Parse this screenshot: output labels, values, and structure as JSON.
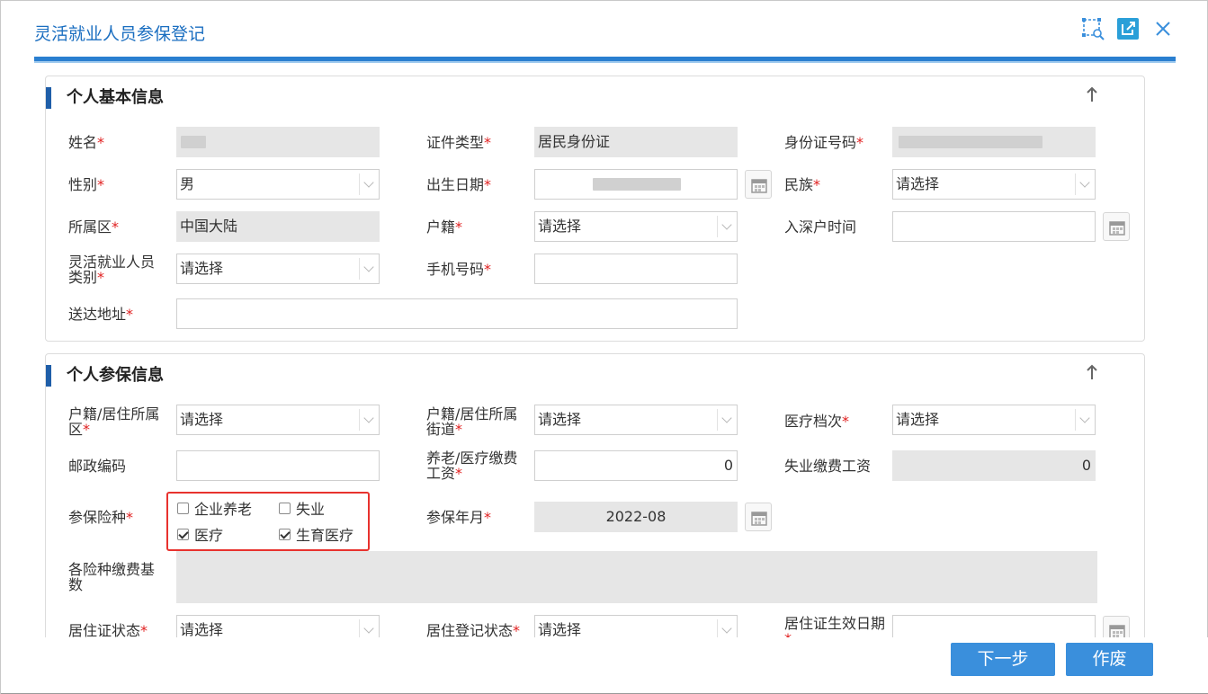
{
  "dialog": {
    "title": "灵活就业人员参保登记",
    "icons": [
      "screenshot-select-icon",
      "open-external-icon",
      "close-icon"
    ]
  },
  "basic_info": {
    "title": "个人基本信息",
    "name_label": "姓名",
    "id_type_label": "证件类型",
    "id_type_value": "居民身份证",
    "id_number_label": "身份证号码",
    "gender_label": "性别",
    "gender_value": "男",
    "birth_label": "出生日期",
    "ethnicity_label": "民族",
    "ethnicity_value": "请选择",
    "district_label": "所属区",
    "district_value": "中国大陆",
    "household_label": "户籍",
    "household_value": "请选择",
    "settle_time_label": "入深户时间",
    "category_label": "灵活就业人员类别",
    "category_value": "请选择",
    "mobile_label": "手机号码",
    "address_label": "送达地址"
  },
  "insurance_info": {
    "title": "个人参保信息",
    "residence_district_label": "户籍/居住所属区",
    "residence_district_value": "请选择",
    "residence_street_label": "户籍/居住所属街道",
    "residence_street_value": "请选择",
    "medical_level_label": "医疗档次",
    "medical_level_value": "请选择",
    "postcode_label": "邮政编码",
    "pension_wage_label": "养老/医疗缴费工资",
    "pension_wage_value": "0",
    "unemployment_wage_label": "失业缴费工资",
    "unemployment_wage_value": "0",
    "insurance_types_label": "参保险种",
    "insurance_types": [
      {
        "label": "企业养老",
        "checked": false
      },
      {
        "label": "失业",
        "checked": false
      },
      {
        "label": "医疗",
        "checked": true
      },
      {
        "label": "生育医疗",
        "checked": true
      }
    ],
    "start_month_label": "参保年月",
    "start_month_value": "2022-08",
    "base_label": "各险种缴费基数",
    "permit_status_label": "居住证状态",
    "permit_status_value": "请选择",
    "registration_status_label": "居住登记状态",
    "registration_status_value": "请选择",
    "permit_effective_label": "居住证生效日期"
  },
  "footer": {
    "next_label": "下一步",
    "void_label": "作废"
  },
  "colors": {
    "accent": "#3a8fdc",
    "title": "#1a6ec0",
    "required": "#e02020",
    "highlight": "#e8322e"
  }
}
